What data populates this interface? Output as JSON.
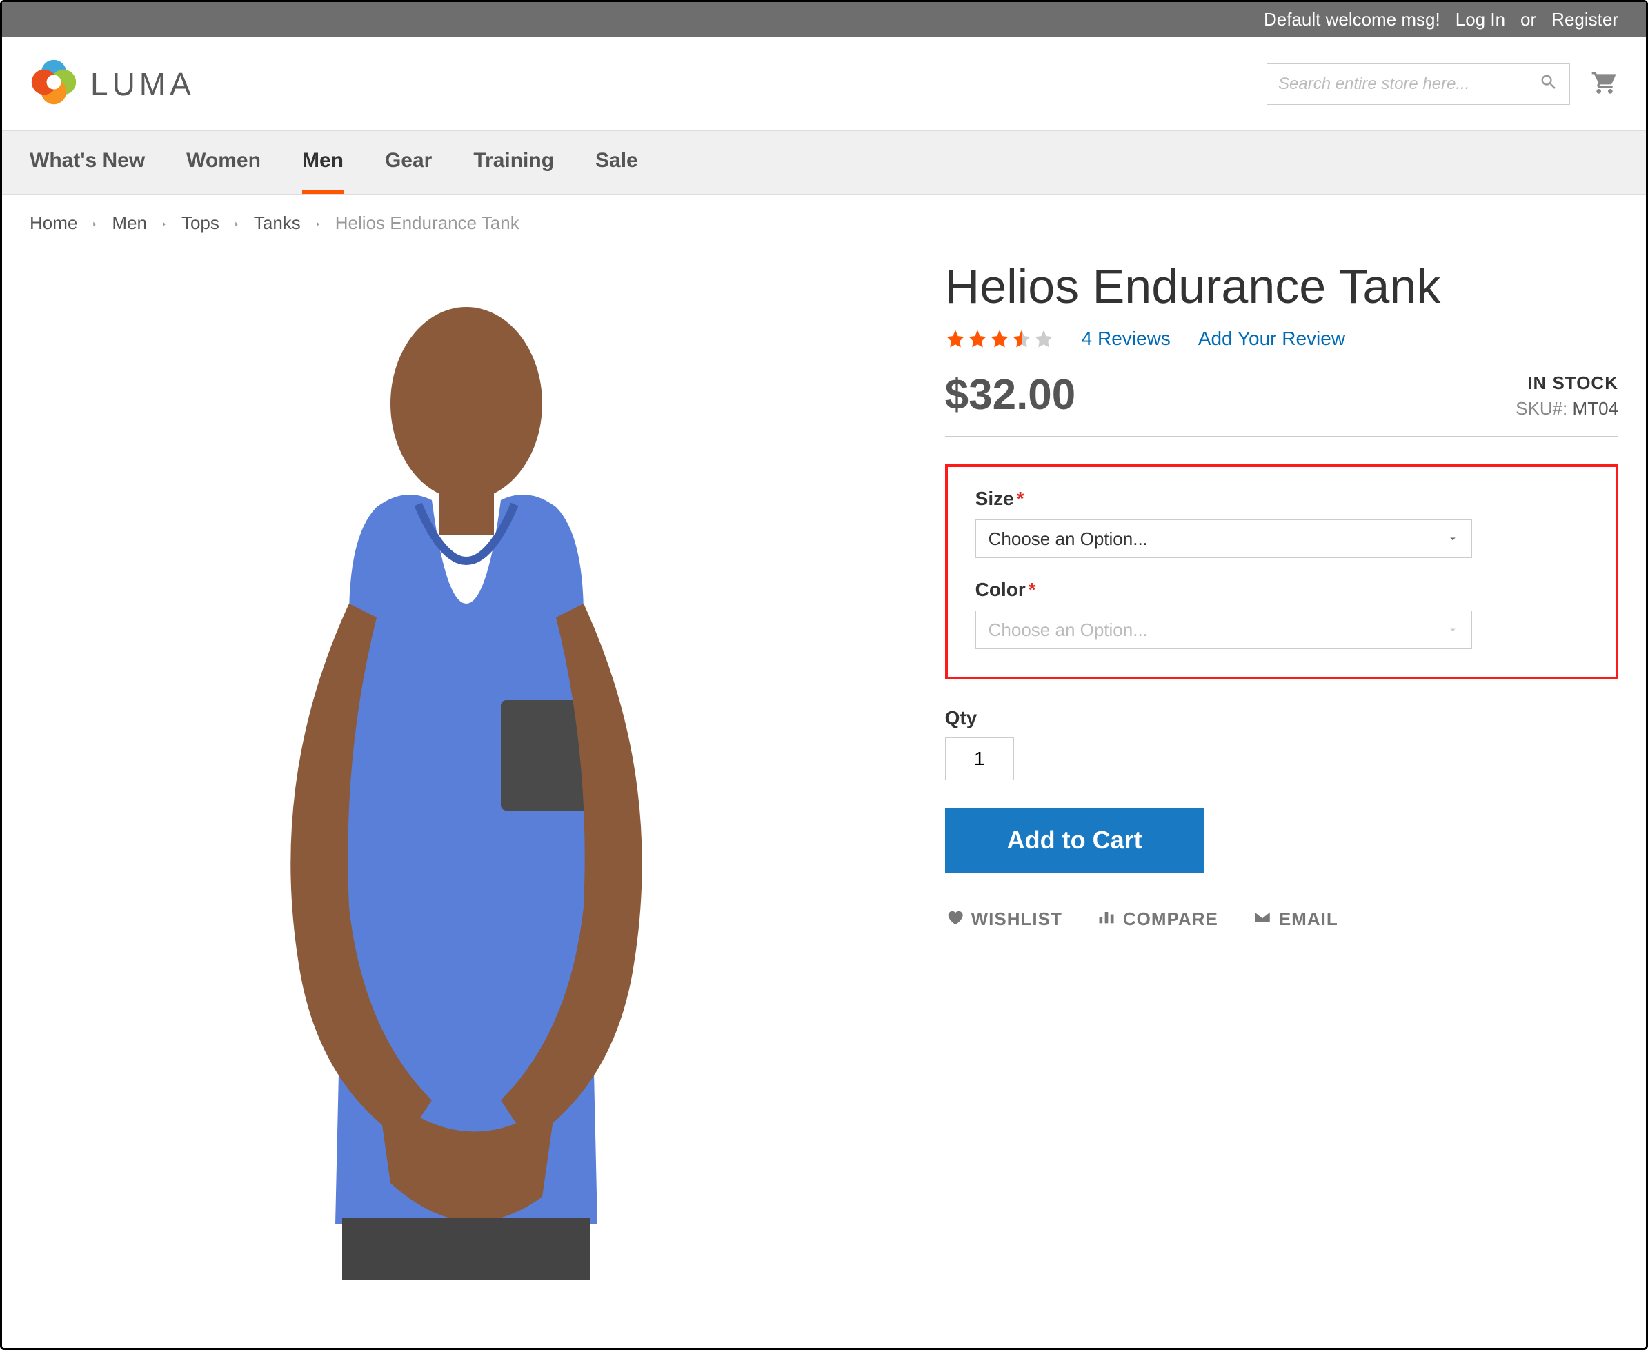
{
  "util": {
    "welcome": "Default welcome msg!",
    "login": "Log In",
    "or": "or",
    "register": "Register"
  },
  "header": {
    "brand": "LUMA",
    "search_placeholder": "Search entire store here..."
  },
  "nav": {
    "items": [
      "What's New",
      "Women",
      "Men",
      "Gear",
      "Training",
      "Sale"
    ],
    "active_index": 2
  },
  "breadcrumb": {
    "items": [
      "Home",
      "Men",
      "Tops",
      "Tanks",
      "Helios Endurance Tank"
    ]
  },
  "product": {
    "title": "Helios Endurance Tank",
    "rating": 3.5,
    "reviews_link": "4 Reviews",
    "add_review_link": "Add Your Review",
    "price": "$32.00",
    "stock_label": "IN STOCK",
    "sku_label": "SKU#:",
    "sku_value": "MT04",
    "size": {
      "label": "Size",
      "placeholder": "Choose an Option..."
    },
    "color": {
      "label": "Color",
      "placeholder": "Choose an Option..."
    },
    "qty_label": "Qty",
    "qty_value": "1",
    "add_to_cart": "Add to Cart",
    "addto": {
      "wishlist": "WISHLIST",
      "compare": "COMPARE",
      "email": "EMAIL"
    }
  }
}
